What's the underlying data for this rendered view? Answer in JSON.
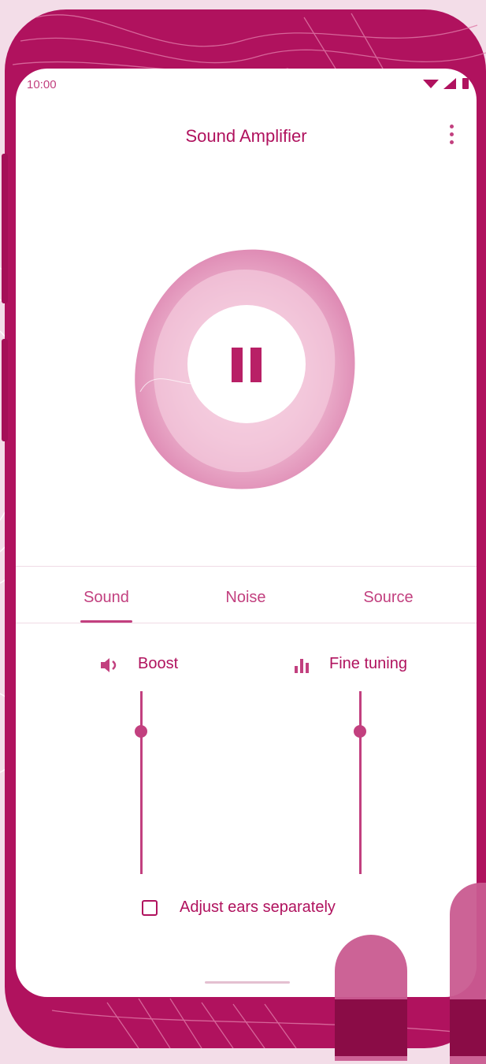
{
  "status_bar": {
    "time": "10:00",
    "icons": [
      "wifi-icon",
      "signal-icon",
      "battery-icon"
    ]
  },
  "app": {
    "title": "Sound Amplifier",
    "menu_icon": "more-vert-icon",
    "main_button_icon": "pause-icon"
  },
  "tabs": [
    {
      "label": "Sound",
      "selected": true
    },
    {
      "label": "Noise",
      "selected": false
    },
    {
      "label": "Source",
      "selected": false
    }
  ],
  "controls": {
    "boost": {
      "label": "Boost",
      "icon": "volume-icon",
      "level": 0.78
    },
    "fine_tuning": {
      "label": "Fine tuning",
      "icon": "equalizer-icon",
      "level": 0.78
    }
  },
  "checkbox": {
    "label": "Adjust ears separately",
    "checked": false
  },
  "colors": {
    "accent": "#c2407f",
    "frame": "#b0125e",
    "background": "#f3dde8",
    "screen": "#ffffff"
  }
}
